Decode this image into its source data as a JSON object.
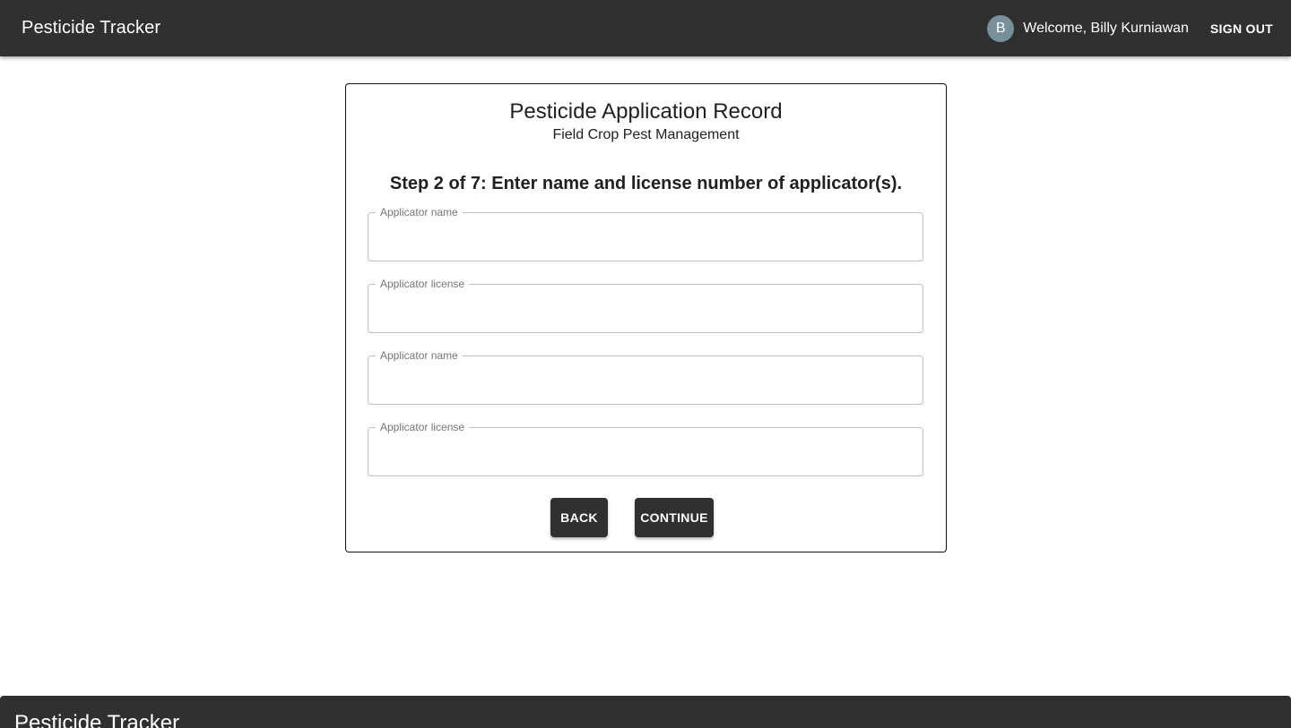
{
  "appbar": {
    "title": "Pesticide Tracker",
    "avatar_initial": "B",
    "welcome_text": "Welcome, Billy Kurniawan",
    "signout_label": "SIGN OUT"
  },
  "form": {
    "title": "Pesticide Application Record",
    "subtitle": "Field Crop Pest Management",
    "step_heading": "Step 2 of 7: Enter name and license number of applicator(s).",
    "fields": [
      {
        "label": "Applicator name",
        "value": ""
      },
      {
        "label": "Applicator license",
        "value": ""
      },
      {
        "label": "Applicator name",
        "value": ""
      },
      {
        "label": "Applicator license",
        "value": ""
      }
    ],
    "back_label": "BACK",
    "continue_label": "CONTINUE"
  },
  "footer": {
    "title": "Pesticide Tracker"
  },
  "colors": {
    "appbar_bg": "#303030",
    "avatar_bg": "#78909c",
    "button_bg": "#303030"
  }
}
